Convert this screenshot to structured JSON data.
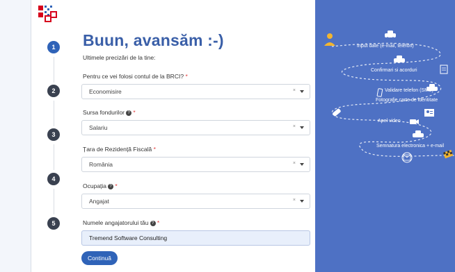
{
  "page": {
    "title": "Buun, avansăm :-)",
    "subtitle": "Ultimele precizări de la tine:"
  },
  "steps": [
    "1",
    "2",
    "3",
    "4",
    "5"
  ],
  "form": {
    "usage_label": "Pentru ce vei folosi contul de la BRCI?",
    "usage_value": "Economisire",
    "source_label": "Sursa fondurilor",
    "source_value": "Salariu",
    "country_label": "Țara de Rezidență Fiscală",
    "country_value": "România",
    "occupation_label": "Ocupația",
    "occupation_value": "Angajat",
    "employer_label": "Numele angajatorului tău",
    "employer_value": "Tremend Software Consulting",
    "required_mark": "*",
    "info_mark": "?",
    "clear_mark": "×",
    "continue_label": "Continuă"
  },
  "roadmap": [
    "Input date (e-mail, telefon)",
    "Confirmari si acorduri",
    "Validare telefon (SMS)",
    "Fotografie carte de identitate",
    "Apel video",
    "Semnatura electronica + e-mail"
  ],
  "colors": {
    "accent": "#2f63b8",
    "title": "#3a5fa8",
    "panel": "#4e71c4",
    "logo_red": "#d6001c",
    "logo_blue": "#2f63b8",
    "step_dark": "#3a4150",
    "required": "#e23a3a",
    "person_yellow": "#f2b530"
  },
  "icons": [
    "logo",
    "step-number",
    "person-icon",
    "car-icon",
    "clipboard-icon",
    "phone-icon",
    "id-card-icon",
    "video-camera-icon",
    "envelope-icon",
    "checkered-flag-icon"
  ]
}
